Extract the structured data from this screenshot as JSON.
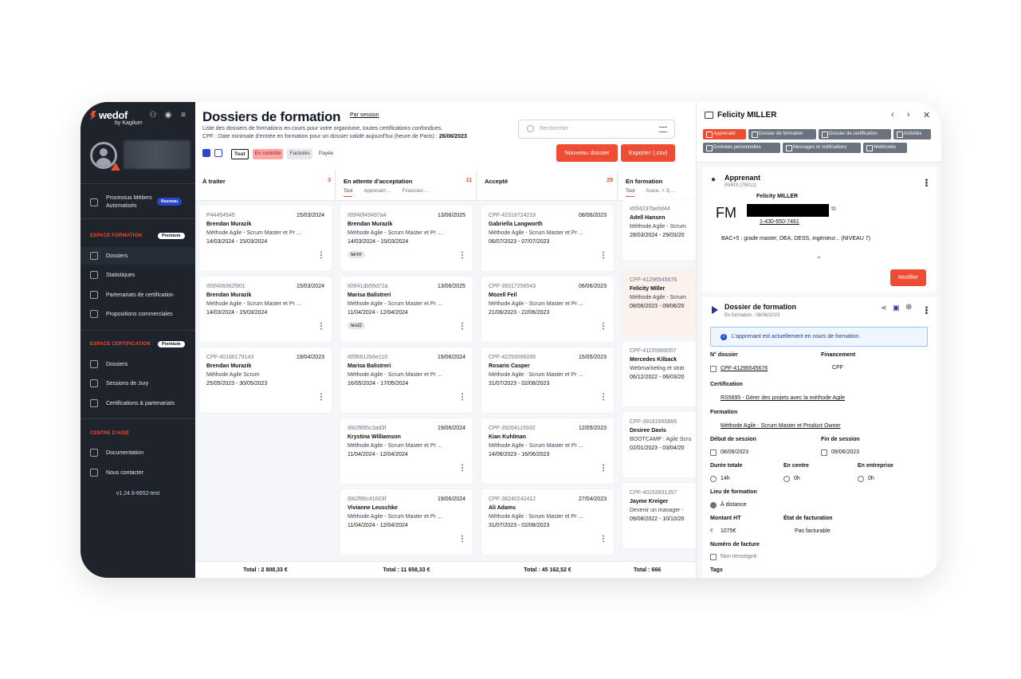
{
  "sidebar": {
    "logo": "wedof",
    "logo_sub": "by Kagilum",
    "processus": {
      "label1": "Processus Métiers",
      "label2": "Automatisés",
      "badge": "Nouveau"
    },
    "formation_section": {
      "title": "ESPACE FORMATION",
      "badge": "Premium"
    },
    "formation_items": [
      {
        "label": "Dossiers"
      },
      {
        "label": "Statistiques"
      },
      {
        "label": "Partenariats de certification"
      },
      {
        "label": "Propositions commerciales"
      }
    ],
    "certification_section": {
      "title": "ESPACE CERTIFICATION",
      "badge": "Premium"
    },
    "certification_items": [
      {
        "label": "Dossiers"
      },
      {
        "label": "Sessions de Jury"
      },
      {
        "label": "Certifications & partenariats"
      }
    ],
    "help_section": {
      "title": "CENTRE D'AIDE"
    },
    "help_items": [
      {
        "label": "Documentation"
      },
      {
        "label": "Nous contacter"
      }
    ],
    "version": "v1.24.8-6652-test"
  },
  "header": {
    "title": "Dossiers de formation",
    "by_session": "Par session",
    "desc1": "Liste des dossiers de formations en cours pour votre organisme, toutes certifications confondues.",
    "desc2_prefix": "CPF : Date minimale d'entrée en formation pour un dossier validé aujourd'hui (heure de Paris) :",
    "desc2_date": "26/06/2023",
    "filters": [
      "Tout",
      "En contrôle",
      "Facturés",
      "Payée"
    ],
    "search_placeholder": "Rechercher",
    "new_button": "Nouveau dossier",
    "export_button": "Exporter (.csv)"
  },
  "columns": [
    {
      "name": "À traiter",
      "count": "3",
      "tabs": [],
      "total": "Total : 2 808,33 €",
      "cards": [
        {
          "id": "P44454545",
          "date": "15/03/2024",
          "name": "Brendan Murazik",
          "cert": "Méthode Agile - Scrum Master et Pr ...",
          "period": "14/03/2024 - 15/03/2024",
          "tag": ""
        },
        {
          "id": "I65f406062f901",
          "date": "15/03/2024",
          "name": "Brendan Murazik",
          "cert": "Méthode Agile - Scrum Master et Pr ...",
          "period": "14/03/2024 - 15/03/2024",
          "tag": ""
        },
        {
          "id": "CPF-40166179143",
          "date": "19/04/2023",
          "name": "Brendan Murazik",
          "cert": "Méthode Agile Scrum",
          "period": "25/05/2023 - 30/05/2023",
          "tag": ""
        }
      ]
    },
    {
      "name": "En attente d'acceptation",
      "count": "11",
      "tabs": [
        "Tout",
        "Apprenant ...",
        "Financeur ..."
      ],
      "total": "Total : 11 658,33 €",
      "cards": [
        {
          "id": "I65f40f49497a4",
          "date": "13/06/2025",
          "name": "Brendan Murazik",
          "cert": "Méthode Agile - Scrum Master et Pr ...",
          "period": "14/03/2024 - 15/03/2024",
          "tag": "terrrr"
        },
        {
          "id": "I65f41db56d72a",
          "date": "13/06/2025",
          "name": "Marisa Balistreri",
          "cert": "Méthode Agile - Scrum Master et Pr ...",
          "period": "11/04/2024 - 12/04/2024",
          "tag": "test2"
        },
        {
          "id": "I65f6612b6e110",
          "date": "19/06/2024",
          "name": "Marisa Balistreri",
          "cert": "Méthode Agile - Scrum Master et Pr ...",
          "period": "16/05/2024 - 17/05/2024",
          "tag": ""
        },
        {
          "id": "I662f895c3ad3f",
          "date": "19/06/2024",
          "name": "Krystina Williamson",
          "cert": "Méthode Agile - Scrum Master et Pr ...",
          "period": "11/04/2024 - 12/04/2024",
          "tag": ""
        },
        {
          "id": "I662f96c41603f",
          "date": "19/06/2024",
          "name": "Vivianne Leuschke",
          "cert": "Méthode Agile - Scrum Master et Pr ...",
          "period": "11/04/2024 - 12/04/2024",
          "tag": ""
        }
      ]
    },
    {
      "name": "Accepté",
      "count": "29",
      "tabs": [],
      "total": "Total : 45 162,52 €",
      "cards": [
        {
          "id": "CPF-42318724218",
          "date": "08/06/2023",
          "name": "Gabriella Langworth",
          "cert": "Méthode Agile - Scrum Master et Pr ...",
          "period": "06/07/2023 - 07/07/2023",
          "tag": ""
        },
        {
          "id": "CPF-39317256543",
          "date": "06/06/2023",
          "name": "Mozell Feil",
          "cert": "Méthode Agile - Scrum Master et Pr ...",
          "period": "21/06/2023 - 22/06/2023",
          "tag": ""
        },
        {
          "id": "CPF-42293096095",
          "date": "15/05/2023",
          "name": "Rosario Casper",
          "cert": "Méthode Agile : Scrum Master et Pr ...",
          "period": "31/07/2023 - 02/08/2023",
          "tag": ""
        },
        {
          "id": "CPF-39264115932",
          "date": "12/05/2023",
          "name": "Kian Kuhlman",
          "cert": "Méthode Agile - Scrum Master et Pr ...",
          "period": "14/06/2023 - 16/06/2023",
          "tag": ""
        },
        {
          "id": "CPF-38240242412",
          "date": "27/04/2023",
          "name": "Ali Adams",
          "cert": "Méthode Agile : Scrum Master et Pr ...",
          "period": "31/07/2023 - 02/08/2023",
          "tag": ""
        }
      ]
    },
    {
      "name": "En formation",
      "count": "",
      "tabs": [
        "Tout",
        "Avanc. > 3j ..."
      ],
      "total": "Total : 666",
      "cards": [
        {
          "id": "I65f4237be0d44",
          "date": "",
          "name": "Adell Hansen",
          "cert": "Méthode Agile - Scrum",
          "period": "28/03/2024 - 29/03/20",
          "tag": ""
        },
        {
          "id": "CPF-41296545676",
          "date": "",
          "name": "Felicity Miller",
          "cert": "Méthode Agile - Scrum",
          "period": "08/06/2023 - 09/06/20",
          "tag": ""
        },
        {
          "id": "CPF-41155968357",
          "date": "",
          "name": "Mercedes Kilback",
          "cert": "Webmarketing et strat",
          "period": "06/12/2022 - 06/03/20",
          "tag": ""
        },
        {
          "id": "CPF-39161665666",
          "date": "",
          "name": "Desiree Davis",
          "cert": "BOOTCAMP : Agile Scru",
          "period": "02/01/2023 - 03/04/20",
          "tag": ""
        },
        {
          "id": "CPF-40153931357",
          "date": "",
          "name": "Jayme Kreiger",
          "cert": "Devenir un manager -",
          "period": "09/08/2022 - 10/10/20",
          "tag": ""
        }
      ]
    }
  ],
  "panel": {
    "name": "Felicity MILLER",
    "tabs": [
      "Apprenant",
      "Dossier de formation",
      "Dossier de certification",
      "Activités",
      "Données personnelles",
      "Messages et notifications",
      "Webhooks"
    ],
    "apprenant": {
      "title": "Apprenant",
      "city": "PARIS (75012)",
      "initials": "FM",
      "fullname": "Felicity MILLER",
      "phone": "1-430-650-7461",
      "diploma": "BAC+5 : grade master, DEA, DESS, ingénieur... (NIVEAU 7)",
      "modify": "Modifier"
    },
    "dossier": {
      "title": "Dossier de formation",
      "subtitle": "En formation - 08/06/2023",
      "info": "L'apprenant est actuellement en cours de formation.",
      "num_label": "N° dossier",
      "num": "CPF-41296545676",
      "fin_label": "Financement",
      "fin": "CPF",
      "cert_label": "Certification",
      "cert": "RS5695 - Gérer des projets avec la méthode Agile",
      "form_label": "Formation",
      "form": "Méthode Agile - Scrum Master et Product Owner",
      "debut_label": "Début de session",
      "debut": "08/06/2023",
      "finsess_label": "Fin de session",
      "finsess": "09/06/2023",
      "duree_label": "Durée totale",
      "duree": "14h",
      "centre_label": "En centre",
      "centre": "0h",
      "entreprise_label": "En entreprise",
      "entreprise": "0h",
      "lieu_label": "Lieu de formation",
      "lieu": "À distance",
      "montant_label": "Montant HT",
      "montant": "1075€",
      "etat_label": "État de facturation",
      "etat": "Pas facturable",
      "facture_label": "Numéro de facture",
      "facture": "Non renseigné",
      "tags_label": "Tags"
    }
  },
  "colors": {
    "accent": "#ef4d33",
    "sidebar": "#1e232c",
    "blue": "#2a47c9"
  }
}
